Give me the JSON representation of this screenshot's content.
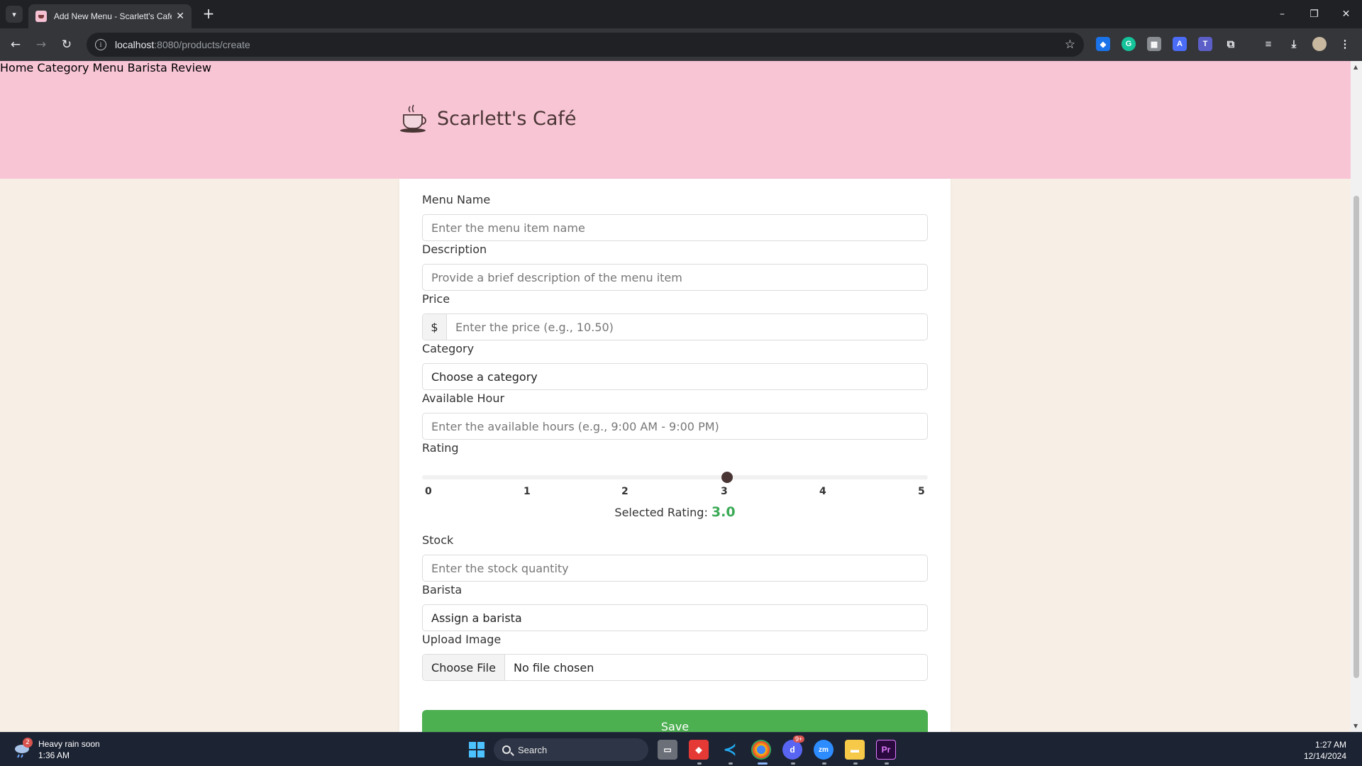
{
  "browser": {
    "tab_title": "Add New Menu - Scarlett's Café",
    "tab_close": "✕",
    "new_tab": "+",
    "url_host": "localhost",
    "url_rest": ":8080/products/create",
    "window_controls": [
      "–",
      "❐",
      "✕"
    ]
  },
  "site": {
    "brand": "Scarlett's Café",
    "nav": [
      "Home",
      "Category",
      "Menu",
      "Barista",
      "Review"
    ]
  },
  "form": {
    "menu_name": {
      "label": "Menu Name",
      "placeholder": "Enter the menu item name"
    },
    "description": {
      "label": "Description",
      "placeholder": "Provide a brief description of the menu item"
    },
    "price": {
      "label": "Price",
      "prefix": "$",
      "placeholder": "Enter the price (e.g., 10.50)"
    },
    "category": {
      "label": "Category",
      "value": "Choose a category"
    },
    "available_hour": {
      "label": "Available Hour",
      "placeholder": "Enter the available hours (e.g., 9:00 AM - 9:00 PM)"
    },
    "rating": {
      "label": "Rating",
      "ticks": [
        "0",
        "1",
        "2",
        "3",
        "4",
        "5"
      ],
      "min": 0,
      "max": 5,
      "value": 3,
      "selected_label": "Selected Rating:",
      "selected_value": "3.0"
    },
    "stock": {
      "label": "Stock",
      "placeholder": "Enter the stock quantity"
    },
    "barista": {
      "label": "Barista",
      "value": "Assign a barista"
    },
    "upload": {
      "label": "Upload Image",
      "button": "Choose File",
      "status": "No file chosen"
    },
    "save": "Save"
  },
  "taskbar": {
    "weather_title": "Heavy rain soon",
    "weather_time": "1:36 AM",
    "weather_badge": "2",
    "search": "Search",
    "time": "1:27 AM",
    "date": "12/14/2024",
    "discord_badge": "9+"
  },
  "colors": {
    "header_bg": "#f8c5d5",
    "page_bg": "#f7efe5",
    "save_button": "#4caf50",
    "rating_value": "#3aaa55"
  }
}
